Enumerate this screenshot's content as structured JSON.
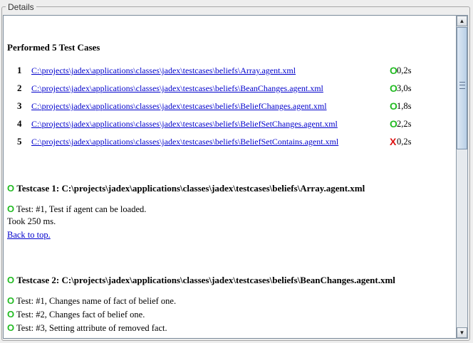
{
  "panel": {
    "title": "Details"
  },
  "report": {
    "summary_title": "Performed 5 Test Cases",
    "cases": [
      {
        "num": "1",
        "path": "C:\\projects\\jadex\\applications\\classes\\jadex\\testcases\\beliefs\\Array.agent.xml",
        "status": "O",
        "time": "0,2s"
      },
      {
        "num": "2",
        "path": "C:\\projects\\jadex\\applications\\classes\\jadex\\testcases\\beliefs\\BeanChanges.agent.xml",
        "status": "O",
        "time": "3,0s"
      },
      {
        "num": "3",
        "path": "C:\\projects\\jadex\\applications\\classes\\jadex\\testcases\\beliefs\\BeliefChanges.agent.xml",
        "status": "O",
        "time": "1,8s"
      },
      {
        "num": "4",
        "path": "C:\\projects\\jadex\\applications\\classes\\jadex\\testcases\\beliefs\\BeliefSetChanges.agent.xml",
        "status": "O",
        "time": "2,2s"
      },
      {
        "num": "5",
        "path": "C:\\projects\\jadex\\applications\\classes\\jadex\\testcases\\beliefs\\BeliefSetContains.agent.xml",
        "status": "X",
        "time": "0,2s"
      }
    ],
    "sections": [
      {
        "mark": "O",
        "heading": "Testcase 1:  C:\\projects\\jadex\\applications\\classes\\jadex\\testcases\\beliefs\\Array.agent.xml",
        "tests": [
          {
            "mark": "O",
            "text": "Test: #1, Test if agent can be loaded."
          }
        ],
        "took": "Took 250 ms.",
        "back": "Back to top."
      },
      {
        "mark": "O",
        "heading": "Testcase 2:  C:\\projects\\jadex\\applications\\classes\\jadex\\testcases\\beliefs\\BeanChanges.agent.xml",
        "tests": [
          {
            "mark": "O",
            "text": "Test: #1, Changes name of fact of belief one."
          },
          {
            "mark": "O",
            "text": "Test: #2, Changes fact of belief one."
          },
          {
            "mark": "O",
            "text": "Test: #3, Setting attribute of removed fact."
          }
        ]
      }
    ]
  },
  "colors": {
    "pass": "#22bb22",
    "fail": "#dd1111",
    "link": "#0000cc"
  }
}
